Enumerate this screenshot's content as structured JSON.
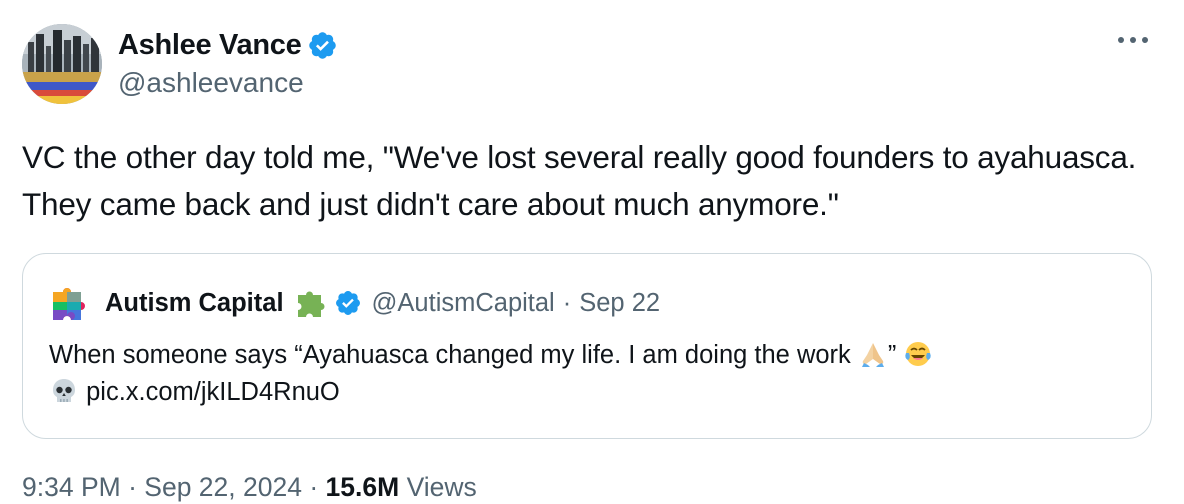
{
  "author": {
    "display_name": "Ashlee Vance",
    "handle": "@ashleevance",
    "verified": true
  },
  "tweet": {
    "text": "VC the other day told me, \"We've lost several really good founders to ayahuasca. They came back and just didn't care about much anymore.\""
  },
  "quoted_tweet": {
    "display_name": "Autism Capital",
    "handle": "@AutismCapital",
    "separator": "·",
    "date": "Sep 22",
    "text_part1": "When someone says “Ayahuasca changed my life. I am doing the work ",
    "text_part2": "” ",
    "link": "pic.x.com/jkILD4RnuO"
  },
  "meta": {
    "time": "9:34 PM",
    "separator": "·",
    "date": "Sep 22, 2024",
    "separator2": "·",
    "views_count": "15.6M",
    "views_label": "Views"
  },
  "icons": {
    "verified": "verified-badge-icon",
    "more": "more-options-icon",
    "puzzle": "puzzle-piece-emoji",
    "pray": "folded-hands-emoji",
    "laugh": "tears-of-joy-emoji",
    "skull": "skull-emoji"
  },
  "colors": {
    "verified_blue": "#1d9bf0",
    "secondary_text": "#536471",
    "primary_text": "#0f1419",
    "border": "#cfd9de"
  }
}
